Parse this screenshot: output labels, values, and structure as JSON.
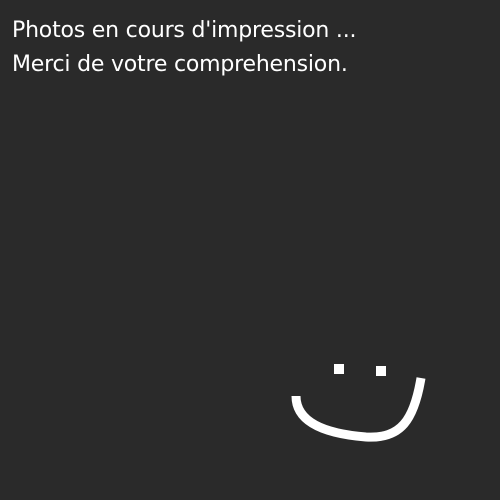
{
  "message": {
    "line1": "Photos en cours d'impression ...",
    "line2": "Merci de votre comprehension."
  },
  "graphics": {
    "smiley": "smiley-face-icon"
  },
  "colors": {
    "background": "#2a2a2a",
    "text": "#ffffff",
    "smiley": "#ffffff"
  }
}
